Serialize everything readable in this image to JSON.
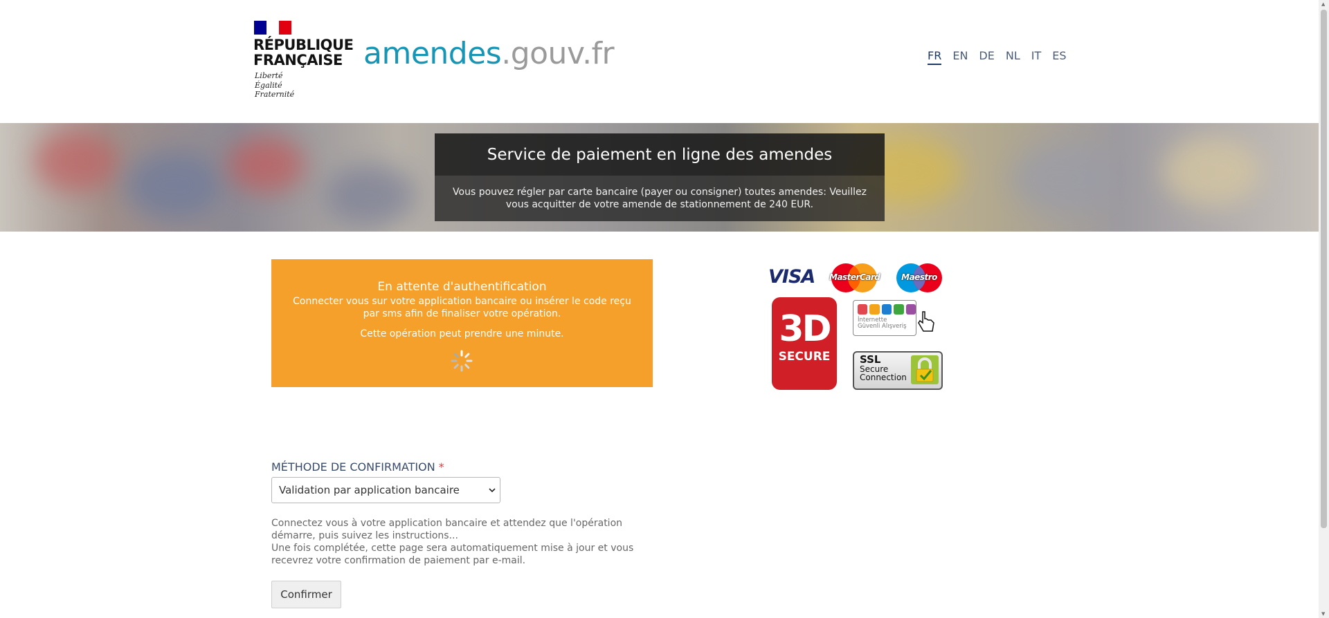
{
  "header": {
    "republique_line1": "RÉPUBLIQUE",
    "republique_line2": "FRANÇAISE",
    "devise": [
      "Liberté",
      "Égalité",
      "Fraternité"
    ],
    "site_name_part1": "amendes",
    "site_name_part2": ".gouv.fr",
    "languages": [
      "FR",
      "EN",
      "DE",
      "NL",
      "IT",
      "ES"
    ],
    "active_language": "FR"
  },
  "banner": {
    "title": "Service de paiement en ligne des amendes",
    "text": "Vous pouvez régler par carte bancaire (payer ou consigner) toutes amendes: Veuillez vous acquitter de votre amende de stationnement de 240 EUR."
  },
  "auth_panel": {
    "title": "En attente d'authentification",
    "description": "Connecter vous sur votre application bancaire ou insérer le code reçu par sms afin de finaliser votre opération.",
    "wait_text": "Cette opération peut prendre une minute.",
    "background_color": "#f5a02a"
  },
  "payment_logos": {
    "visa": "VISA",
    "mastercard": "MasterCard",
    "maestro": "Maestro",
    "secure3d_big": "3D",
    "secure3d_small": "SECURE",
    "igas_line1": "İnternette",
    "igas_line2": "Güvenli Alışveriş",
    "ssl_line1": "SSL",
    "ssl_line2": "Secure",
    "ssl_line3": "Connection"
  },
  "form": {
    "method_label": "MÉTHODE DE CONFIRMATION",
    "required_marker": "*",
    "selected_method": "Validation par application bancaire",
    "instructions_1": "Connectez vous à votre application bancaire et attendez que l'opération démarre, puis suivez les instructions...",
    "instructions_2": "Une fois complétée, cette page sera automatiquement mise à jour et vous recevrez votre confirmation de paiement par e-mail.",
    "confirm_label": "Confirmer"
  },
  "colors": {
    "brand_blue": "#1795b5",
    "brand_grey": "#9a9a9a",
    "flag_blue": "#000091",
    "flag_red": "#e1000f"
  }
}
